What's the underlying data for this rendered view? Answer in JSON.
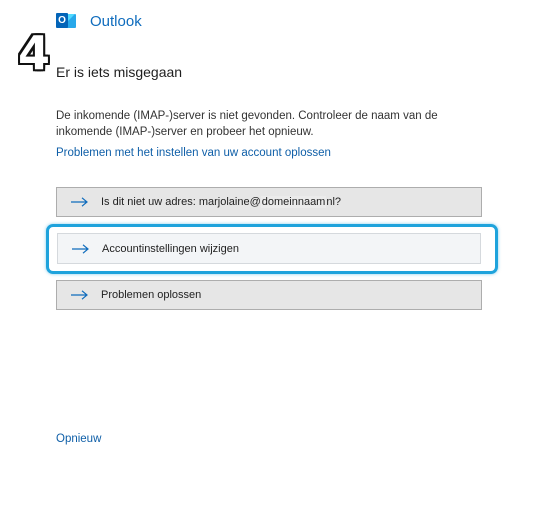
{
  "app": {
    "title": "Outlook",
    "logo_letter": "O"
  },
  "overlay": {
    "step_number": "4"
  },
  "error": {
    "heading": "Er is iets misgegaan",
    "message": "De inkomende (IMAP-)server is niet gevonden. Controleer de naam van de inkomende (IMAP-)server en probeer het opnieuw.",
    "help_link": "Problemen met het instellen van uw account oplossen"
  },
  "actions": [
    {
      "label_prefix": "Is dit niet uw adres: marjolaine@",
      "label_masked": "domeinnaam",
      "label_suffix": "nl?"
    },
    {
      "label": "Accountinstellingen wijzigen"
    },
    {
      "label": "Problemen oplossen"
    }
  ],
  "footer": {
    "retry_link": "Opnieuw"
  },
  "colors": {
    "accent": "#0f6cbd",
    "link": "#0f5fa8",
    "highlight": "#1fa3dc",
    "button_bg": "#e6e6e6"
  }
}
